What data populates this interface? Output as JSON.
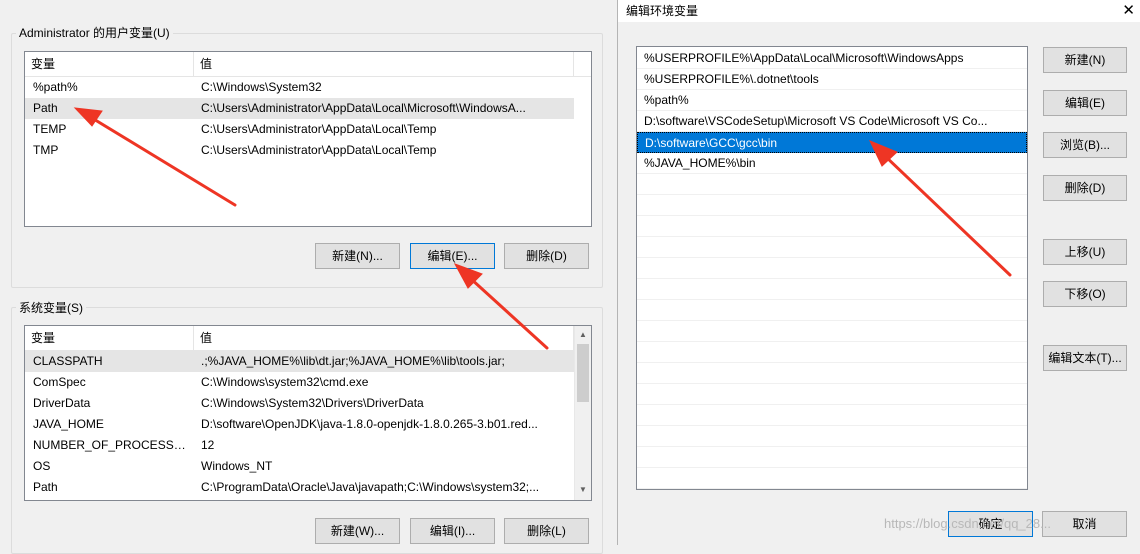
{
  "user_vars": {
    "group_label": "Administrator 的用户变量(U)",
    "header_var": "变量",
    "header_val": "值",
    "rows": [
      {
        "name": "%path%",
        "value": "C:\\Windows\\System32"
      },
      {
        "name": "Path",
        "value": "C:\\Users\\Administrator\\AppData\\Local\\Microsoft\\WindowsA..."
      },
      {
        "name": "TEMP",
        "value": "C:\\Users\\Administrator\\AppData\\Local\\Temp"
      },
      {
        "name": "TMP",
        "value": "C:\\Users\\Administrator\\AppData\\Local\\Temp"
      }
    ],
    "new_label": "新建(N)...",
    "edit_label": "编辑(E)...",
    "delete_label": "删除(D)"
  },
  "system_vars": {
    "group_label": "系统变量(S)",
    "header_var": "变量",
    "header_val": "值",
    "rows": [
      {
        "name": "CLASSPATH",
        "value": ".;%JAVA_HOME%\\lib\\dt.jar;%JAVA_HOME%\\lib\\tools.jar;"
      },
      {
        "name": "ComSpec",
        "value": "C:\\Windows\\system32\\cmd.exe"
      },
      {
        "name": "DriverData",
        "value": "C:\\Windows\\System32\\Drivers\\DriverData"
      },
      {
        "name": "JAVA_HOME",
        "value": "D:\\software\\OpenJDK\\java-1.8.0-openjdk-1.8.0.265-3.b01.red..."
      },
      {
        "name": "NUMBER_OF_PROCESSORS",
        "value": "12"
      },
      {
        "name": "OS",
        "value": "Windows_NT"
      },
      {
        "name": "Path",
        "value": "C:\\ProgramData\\Oracle\\Java\\javapath;C:\\Windows\\system32;..."
      }
    ],
    "new_label": "新建(W)...",
    "edit_label": "编辑(I)...",
    "delete_label": "删除(L)"
  },
  "edit_dialog": {
    "title": "编辑环境变量",
    "close": "✕",
    "paths": [
      "%USERPROFILE%\\AppData\\Local\\Microsoft\\WindowsApps",
      "%USERPROFILE%\\.dotnet\\tools",
      "%path%",
      "D:\\software\\VSCodeSetup\\Microsoft VS Code\\Microsoft VS Co...",
      "D:\\software\\GCC\\gcc\\bin",
      "%JAVA_HOME%\\bin"
    ],
    "buttons": {
      "new": "新建(N)",
      "edit": "编辑(E)",
      "browse": "浏览(B)...",
      "delete": "删除(D)",
      "up": "上移(U)",
      "down": "下移(O)",
      "edit_text": "编辑文本(T)...",
      "ok": "确定",
      "cancel": "取消"
    }
  },
  "watermark": "https://blog.csdn.net/qq_28..."
}
